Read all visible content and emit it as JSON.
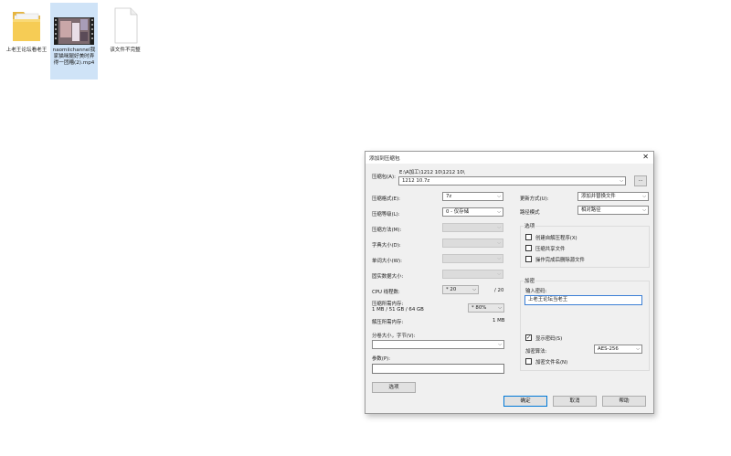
{
  "desktop": {
    "icons": [
      {
        "label": "上老王论坛看老王",
        "type": "folder"
      },
      {
        "label": "naomiichannel我家猫咪腿好美时弄得一团糟(2).mp4",
        "type": "video"
      },
      {
        "label": "该文件不完整",
        "type": "file"
      }
    ]
  },
  "dialog": {
    "title": "添加到压缩包",
    "close_glyph": "✕",
    "archive_label": "压缩包(A):",
    "archive_path": "E:\\A加工\\1212 10\\1212 10\\",
    "archive_name": "1212 10.7z",
    "browse_label": "...",
    "format_label": "压缩格式(E):",
    "format_value": "7z",
    "level_label": "压缩等级(L):",
    "level_value": "0 - 仅存储",
    "method_label": "压缩方法(M):",
    "dict_label": "字典大小(D):",
    "word_label": "单词大小(W):",
    "solid_label": "固实数据大小:",
    "cpu_label": "CPU 线程数:",
    "cpu_value": "* 20",
    "cpu_total": "/ 20",
    "mem_label": "压缩所需内存:",
    "mem_info": "1 MB / 51 GB / 64 GB",
    "mem_pct": "* 80%",
    "mem_needed": "1 MB",
    "decomp_label": "解压所需内存:",
    "decomp_value": "1 MB",
    "split_label": "分卷大小，字节(V):",
    "split_value": "",
    "params_label": "参数(P):",
    "params_value": "",
    "options_button": "选项",
    "update_label": "更新方式(U):",
    "update_value": "添加并替换文件",
    "pathmode_label": "路径模式",
    "pathmode_value": "相对路径",
    "options_group": "选项",
    "opt_sfx": "创建自解压程序(X)",
    "opt_shared": "压缩共享文件",
    "opt_delete": "操作完成后删除源文件",
    "encrypt_group": "加密",
    "password_label": "输入密码:",
    "password_value": "上老王论坛当老王",
    "show_password": "显示密码(S)",
    "show_password_checked": "✓",
    "enc_method_label": "加密算法:",
    "enc_method_value": "AES-256",
    "encrypt_names": "加密文件名(N)",
    "ok_button": "确定",
    "cancel_button": "取消",
    "help_button": "帮助"
  }
}
